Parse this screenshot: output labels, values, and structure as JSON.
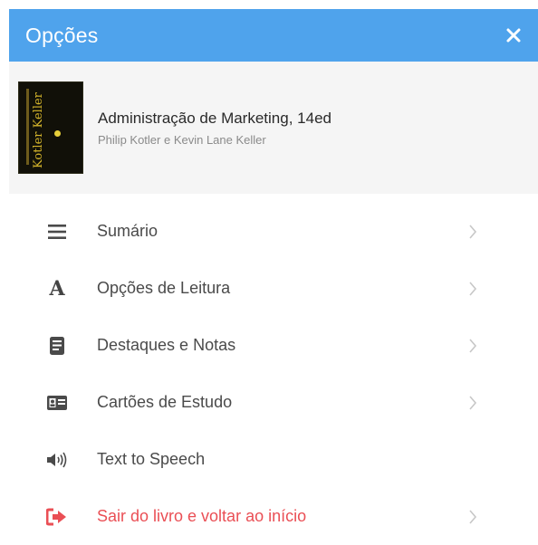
{
  "header": {
    "title": "Opções",
    "close_icon": "close-icon",
    "background_color": "#4fa3ec"
  },
  "book": {
    "title": "Administração de Marketing, 14ed",
    "authors": "Philip Kotler e Kevin Lane Keller",
    "cover_text": "Kotler Keller"
  },
  "menu": {
    "items": [
      {
        "label": "Sumário",
        "icon": "list-icon",
        "has_chevron": true
      },
      {
        "label": "Opções de Leitura",
        "icon": "font-icon",
        "has_chevron": true
      },
      {
        "label": "Destaques e Notas",
        "icon": "notes-icon",
        "has_chevron": true
      },
      {
        "label": "Cartões de Estudo",
        "icon": "study-card-icon",
        "has_chevron": true
      },
      {
        "label": "Text to Speech",
        "icon": "speaker-icon",
        "has_chevron": false
      },
      {
        "label": "Sair do livro e voltar ao início",
        "icon": "exit-icon",
        "has_chevron": true,
        "color": "#ea4f55"
      }
    ]
  }
}
